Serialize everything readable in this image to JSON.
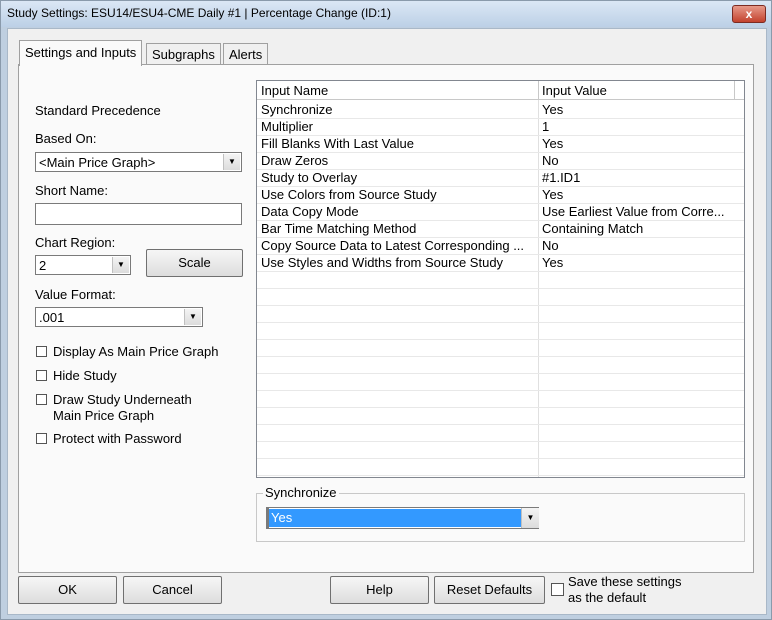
{
  "window": {
    "title": "Study Settings: ESU14/ESU4-CME  Daily  #1 | Percentage Change (ID:1)",
    "close_glyph": "x"
  },
  "tabs": [
    "Settings and Inputs",
    "Subgraphs",
    "Alerts"
  ],
  "left": {
    "precedence": "Standard Precedence",
    "based_on_label": "Based On:",
    "based_on_value": "<Main Price Graph>",
    "short_name_label": "Short Name:",
    "short_name_value": "",
    "chart_region_label": "Chart Region:",
    "chart_region_value": "2",
    "scale_button": "Scale",
    "value_format_label": "Value Format:",
    "value_format_value": ".001",
    "checkboxes": [
      {
        "label": "Display As Main Price Graph",
        "checked": false
      },
      {
        "label": "Hide Study",
        "checked": false
      },
      {
        "label": "Draw Study Underneath",
        "label2": "Main Price Graph",
        "checked": false
      },
      {
        "label": "Protect with Password",
        "checked": false
      }
    ]
  },
  "grid": {
    "headers": [
      "Input Name",
      "Input Value"
    ],
    "rows": [
      [
        "Synchronize",
        "Yes"
      ],
      [
        "Multiplier",
        "1"
      ],
      [
        "Fill Blanks With Last Value",
        "Yes"
      ],
      [
        "Draw Zeros",
        "No"
      ],
      [
        "Study to Overlay",
        "#1.ID1"
      ],
      [
        "Use Colors from Source Study",
        "Yes"
      ],
      [
        "Data Copy Mode",
        "Use Earliest Value from Corre..."
      ],
      [
        "Bar Time Matching Method",
        "Containing Match"
      ],
      [
        "Copy Source Data to Latest Corresponding ...",
        "No"
      ],
      [
        "Use Styles and Widths from Source Study",
        "Yes"
      ]
    ]
  },
  "editor": {
    "label": "Synchronize",
    "value": "Yes"
  },
  "bottom": {
    "ok": "OK",
    "cancel": "Cancel",
    "help": "Help",
    "reset": "Reset Defaults",
    "save_line1": "Save these settings",
    "save_line2": "as the default"
  },
  "colors": {
    "selection": "#3399ff",
    "close_button": "#c3422d"
  }
}
